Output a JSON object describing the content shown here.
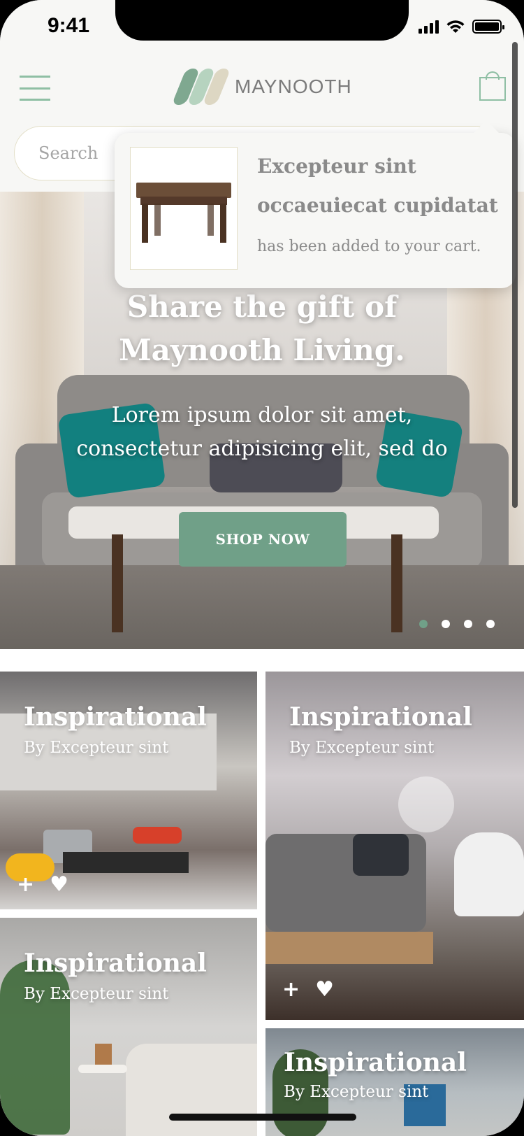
{
  "status_bar": {
    "time": "9:41"
  },
  "header": {
    "brand": "MAYNOOTH",
    "search_placeholder": "Search"
  },
  "cart_popup": {
    "product_name": "Excepteur sint occaeuiecat cupidatat",
    "message": "has been added to your cart."
  },
  "hero": {
    "title_line1": "Share the gift of",
    "title_line2": "Maynooth Living.",
    "subtitle_line1": "Lorem ipsum dolor sit amet,",
    "subtitle_line2": "consectetur adipisicing elit, sed do",
    "cta_label": "SHOP NOW",
    "carousel": {
      "total": 4,
      "active_index": 0
    }
  },
  "cards": [
    {
      "title": "Inspirational",
      "subtitle": "By Excepteur sint",
      "add_icon": "+",
      "like_icon": "♥"
    },
    {
      "title": "Inspirational",
      "subtitle": "By Excepteur sint",
      "add_icon": "+",
      "like_icon": "♥"
    },
    {
      "title": "Inspirational",
      "subtitle": "By Excepteur sint"
    },
    {
      "title": "Inspirational",
      "subtitle": "By Excepteur sint"
    }
  ],
  "colors": {
    "accent": "#70A088",
    "accent_light": "#8FBFA4",
    "text_muted": "#8A8A8A",
    "header_bg": "#F7F7F5"
  },
  "icons": [
    "hamburger-menu-icon",
    "brand-logo-icon",
    "shopping-bag-icon",
    "plus-icon",
    "heart-icon",
    "signal-icon",
    "wifi-icon",
    "battery-icon"
  ]
}
